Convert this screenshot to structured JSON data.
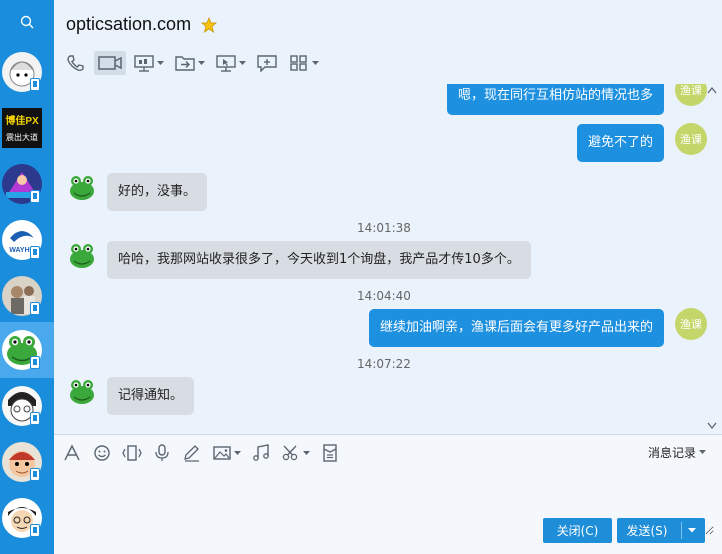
{
  "window": {
    "title": "opticsation.com"
  },
  "rail": {
    "contacts": [
      {
        "name": "contact-1"
      },
      {
        "name": "contact-2"
      },
      {
        "name": "contact-3"
      },
      {
        "name": "contact-4"
      },
      {
        "name": "contact-5"
      },
      {
        "name": "contact-6-active"
      },
      {
        "name": "contact-7"
      },
      {
        "name": "contact-8"
      },
      {
        "name": "contact-9"
      }
    ],
    "contact2_text_top": "博佳PX",
    "contact2_text_bottom": "震出大道",
    "contact4_text": "WAYHA"
  },
  "toolbar": {
    "items": [
      "phone-icon",
      "video-icon",
      "screen-share-icon",
      "file-transfer-icon",
      "remote-desktop-icon",
      "add-chat-icon",
      "apps-icon"
    ]
  },
  "chat": {
    "self_avatar_label": "渔课",
    "messages": [
      {
        "dir": "out",
        "text": "嗯，现在同行互相仿站的情况也多"
      },
      {
        "dir": "out",
        "text": "避免不了的"
      },
      {
        "dir": "in",
        "text": "好的，没事。"
      },
      {
        "time": "14:01:38"
      },
      {
        "dir": "in",
        "text": "哈哈，我那网站收录很多了，今天收到1个询盘，我产品才传10多个。"
      },
      {
        "time": "14:04:40"
      },
      {
        "dir": "out",
        "text": "继续加油啊亲，渔课后面会有更多好产品出来的"
      },
      {
        "time": "14:07:22"
      },
      {
        "dir": "in",
        "text": "记得通知。"
      }
    ]
  },
  "composer": {
    "tools": [
      "font-icon",
      "emoji-icon",
      "shake-icon",
      "voice-icon",
      "draw-icon",
      "image-icon",
      "music-icon",
      "screenshot-icon",
      "red-packet-icon"
    ],
    "history_label": "消息记录",
    "input_value": "",
    "close_label": "关闭(C)",
    "send_label": "发送(S)"
  },
  "colors": {
    "rail": "#1a8ddc",
    "bubble_out": "#1e90e0",
    "bubble_in": "#d8dde3",
    "button": "#1e8ed8"
  }
}
